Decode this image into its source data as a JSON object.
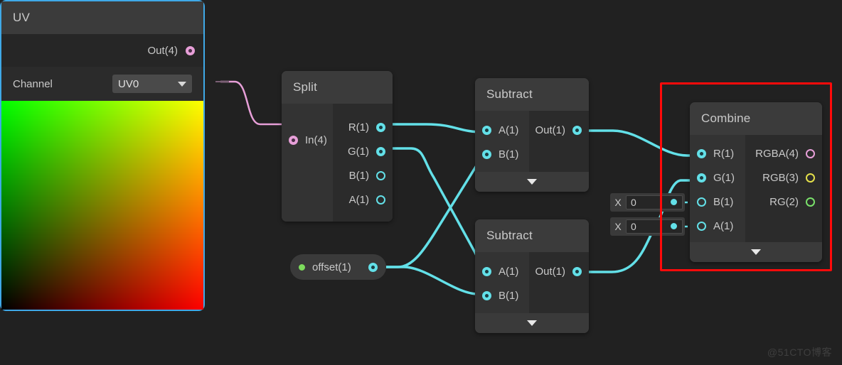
{
  "background": "#212121",
  "accent": {
    "wire_cyan": "#63e0e8",
    "wire_pink": "#e79fd8",
    "highlight_red": "#ff0a0a",
    "selection_blue": "#3fa9e8"
  },
  "uv_node": {
    "title": "UV",
    "output_label": "Out(4)",
    "channel_label": "Channel",
    "channel_value": "UV0"
  },
  "split_node": {
    "title": "Split",
    "input_label": "In(4)",
    "outputs": [
      {
        "label": "R(1)"
      },
      {
        "label": "G(1)"
      },
      {
        "label": "B(1)"
      },
      {
        "label": "A(1)"
      }
    ]
  },
  "subtract_top": {
    "title": "Subtract",
    "inputs": [
      {
        "label": "A(1)"
      },
      {
        "label": "B(1)"
      }
    ],
    "output_label": "Out(1)"
  },
  "subtract_bottom": {
    "title": "Subtract",
    "inputs": [
      {
        "label": "A(1)"
      },
      {
        "label": "B(1)"
      }
    ],
    "output_label": "Out(1)"
  },
  "offset_node": {
    "label": "offset(1)"
  },
  "value_fields": [
    {
      "label": "X",
      "value": "0"
    },
    {
      "label": "X",
      "value": "0"
    }
  ],
  "combine_node": {
    "title": "Combine",
    "inputs": [
      {
        "label": "R(1)"
      },
      {
        "label": "G(1)"
      },
      {
        "label": "B(1)"
      },
      {
        "label": "A(1)"
      }
    ],
    "outputs": [
      {
        "label": "RGBA(4)",
        "color": "#e79fd8"
      },
      {
        "label": "RGB(3)",
        "color": "#e4e04a"
      },
      {
        "label": "RG(2)",
        "color": "#79e06a"
      }
    ]
  },
  "watermark": "@51CTO博客"
}
